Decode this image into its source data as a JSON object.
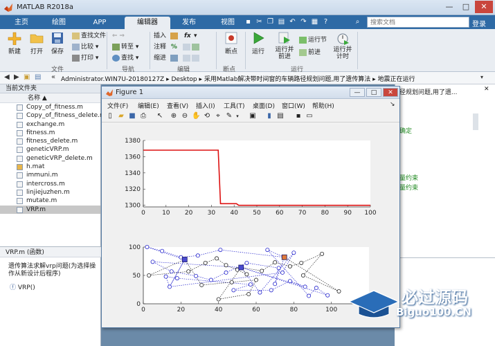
{
  "app": {
    "title": "MATLAB R2018a"
  },
  "window_controls": {
    "minimize": "—",
    "maximize": "□",
    "close": "✕"
  },
  "tabs": [
    "主页",
    "绘图",
    "APP",
    "编辑器",
    "发布",
    "视图"
  ],
  "search": {
    "placeholder": "搜索文档"
  },
  "login": "登录",
  "ribbon": {
    "file": {
      "new": "新建",
      "open": "打开",
      "save": "保存",
      "find_files": "查找文件",
      "compare": "比较",
      "print": "打印",
      "group": "文件"
    },
    "navigate": {
      "goto": "转至",
      "find": "查找",
      "group": "导航"
    },
    "edit": {
      "insert": "插入",
      "comment": "注释",
      "indent": "缩进",
      "fx": "fx",
      "group": "编辑"
    },
    "breakpoints": {
      "breakpoints": "断点",
      "group": "断点"
    },
    "run": {
      "run": "运行",
      "run_advance": "运行并前进",
      "run_section": "运行节",
      "advance": "前进",
      "run_time": "运行并计时",
      "group": "运行"
    }
  },
  "address": {
    "prefix": "«",
    "path": [
      "Administrator.WIN7U-20180127Z",
      "Desktop",
      "采用Matlab解决带时间窗的车辆路径规划问题,用了遗传算法",
      "地震正在运行"
    ]
  },
  "current_folder": {
    "title": "当前文件夹",
    "col_name": "名称 ▲",
    "files": [
      {
        "name": "Copy_of_fitness.m",
        "type": "m"
      },
      {
        "name": "Copy_of_fitness_delete.m",
        "type": "m"
      },
      {
        "name": "exchange.m",
        "type": "m"
      },
      {
        "name": "fitness.m",
        "type": "m"
      },
      {
        "name": "fitness_delete.m",
        "type": "m"
      },
      {
        "name": "geneticVRP.m",
        "type": "m"
      },
      {
        "name": "geneticVRP_delete.m",
        "type": "m"
      },
      {
        "name": "h.mat",
        "type": "mat"
      },
      {
        "name": "immuni.m",
        "type": "m"
      },
      {
        "name": "intercross.m",
        "type": "m"
      },
      {
        "name": "linjiejuzhen.m",
        "type": "m"
      },
      {
        "name": "mutate.m",
        "type": "m"
      },
      {
        "name": "VRP.m",
        "type": "m"
      }
    ],
    "selected": "VRP.m"
  },
  "details": {
    "title": "VRP.m  (函数)",
    "desc": "遗传算法求解vrp问题(为选择操作从新设计后程序)",
    "fn": "VRP()"
  },
  "editor": {
    "title_fragment": "径规划问题,用了遗...",
    "green_lines": [
      "确定",
      "量约束",
      "量约束"
    ]
  },
  "figure": {
    "title": "Figure 1",
    "menus": [
      "文件(F)",
      "编辑(E)",
      "查看(V)",
      "插入(I)",
      "工具(T)",
      "桌面(D)",
      "窗口(W)",
      "帮助(H)"
    ]
  },
  "chart_data": [
    {
      "type": "line",
      "x": [
        0,
        33,
        34,
        35,
        41,
        42,
        43,
        100
      ],
      "y": [
        1368,
        1368,
        1302,
        1302,
        1302,
        1300,
        1300,
        1300
      ],
      "xlim": [
        0,
        100
      ],
      "ylim": [
        1298,
        1380
      ],
      "xticks": [
        0,
        10,
        20,
        30,
        40,
        50,
        60,
        70,
        80,
        90,
        100
      ],
      "yticks": [
        1300,
        1320,
        1340,
        1360,
        1380
      ],
      "color": "#dd1111",
      "grid": false
    },
    {
      "type": "scatter",
      "xlim": [
        0,
        120
      ],
      "ylim": [
        0,
        100
      ],
      "xticks": [
        0,
        20,
        40,
        60,
        80,
        100
      ],
      "yticks": [
        0,
        50,
        100
      ],
      "depots": [
        [
          22,
          78
        ],
        [
          52,
          64
        ],
        [
          75,
          82
        ]
      ],
      "customers_blue": [
        [
          2,
          100
        ],
        [
          5,
          74
        ],
        [
          10,
          93
        ],
        [
          15,
          57
        ],
        [
          20,
          82
        ],
        [
          28,
          49
        ],
        [
          29,
          85
        ],
        [
          36,
          42
        ],
        [
          41,
          95
        ],
        [
          44,
          55
        ],
        [
          48,
          24
        ],
        [
          55,
          72
        ],
        [
          57,
          34
        ],
        [
          66,
          95
        ],
        [
          68,
          24
        ],
        [
          70,
          35
        ],
        [
          72,
          63
        ],
        [
          78,
          40
        ],
        [
          86,
          30
        ],
        [
          92,
          28
        ],
        [
          98,
          15
        ],
        [
          14,
          30
        ],
        [
          12,
          48
        ],
        [
          18,
          45
        ],
        [
          88,
          14
        ],
        [
          80,
          90
        ],
        [
          62,
          20
        ],
        [
          74,
          55
        ]
      ],
      "customers_black": [
        [
          3,
          50
        ],
        [
          24,
          57
        ],
        [
          33,
          72
        ],
        [
          39,
          80
        ],
        [
          44,
          68
        ],
        [
          50,
          60
        ],
        [
          55,
          52
        ],
        [
          63,
          58
        ],
        [
          70,
          73
        ],
        [
          78,
          66
        ],
        [
          95,
          88
        ],
        [
          60,
          42
        ],
        [
          47,
          38
        ],
        [
          31,
          33
        ],
        [
          84,
          72
        ],
        [
          85,
          50
        ],
        [
          104,
          22
        ],
        [
          56,
          17
        ],
        [
          40,
          8
        ]
      ],
      "blue_color": "#2222cc",
      "black_color": "#222222"
    }
  ],
  "watermark": {
    "cn": "必过源码",
    "en": "Biguo100.CN"
  }
}
